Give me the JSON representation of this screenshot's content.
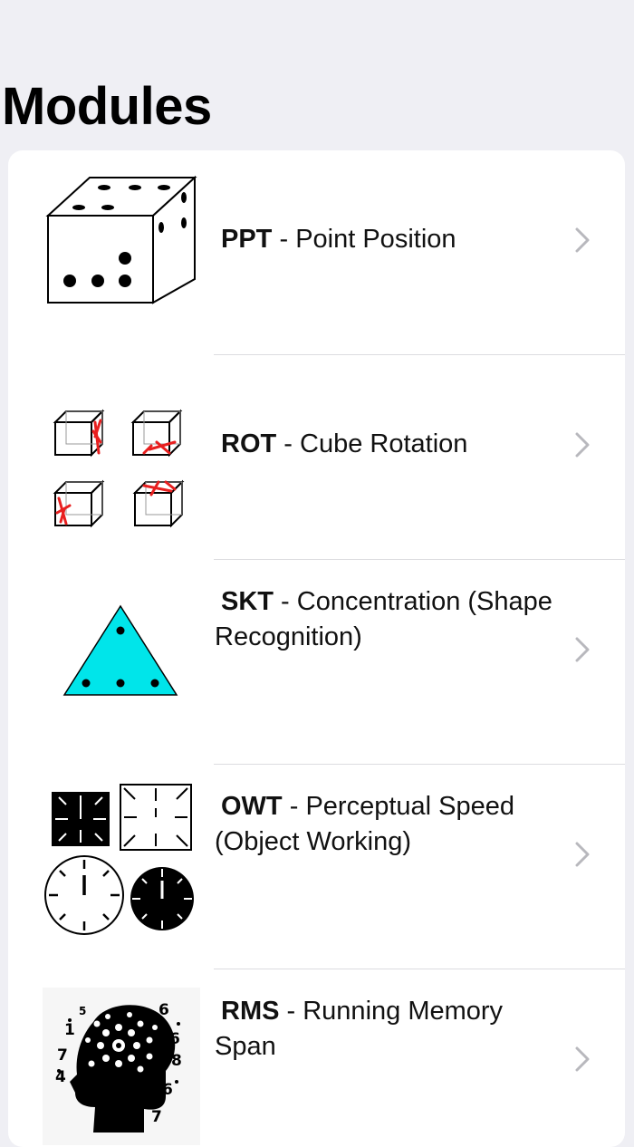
{
  "page": {
    "title": "Modules"
  },
  "modules": [
    {
      "code": "PPT",
      "sep": " - ",
      "name": "Point Position",
      "icon": "dice-icon"
    },
    {
      "code": "ROT",
      "sep": " - ",
      "name": "Cube Rotation",
      "icon": "cube-rotation-icon"
    },
    {
      "code": "SKT",
      "sep": " - ",
      "name": "Concentration (Shape Recognition)",
      "icon": "triangle-dots-icon"
    },
    {
      "code": "OWT",
      "sep": " - ",
      "name": "Perceptual Speed (Object Working)",
      "icon": "clocks-icon"
    },
    {
      "code": "RMS",
      "sep": " - ",
      "name": "Running Memory Span",
      "icon": "head-numbers-icon"
    }
  ],
  "colors": {
    "background": "#efeff4",
    "card": "#ffffff",
    "separator": "#dcdce0",
    "chevron": "#b8b8bd",
    "triangle": "#00e5ea",
    "cube_mark": "#e81f1f"
  },
  "head_numbers": [
    "1",
    "7",
    "4",
    "5",
    "6",
    "6",
    "8",
    "6",
    "7"
  ]
}
